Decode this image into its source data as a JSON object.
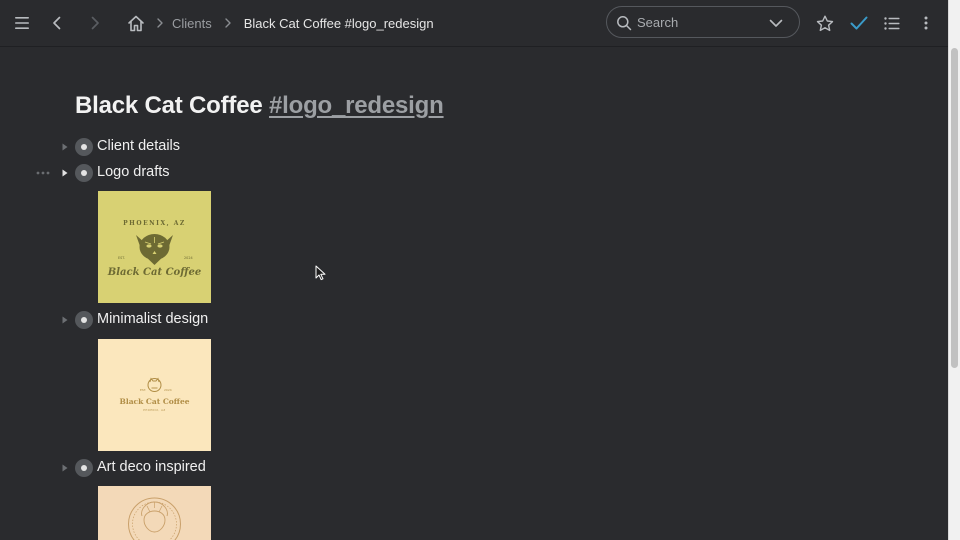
{
  "header": {
    "breadcrumbs": [
      {
        "label": "Clients"
      },
      {
        "label": "Black Cat Coffee #logo_redesign"
      }
    ],
    "search": {
      "placeholder": "Search"
    }
  },
  "page": {
    "title": "Black Cat Coffee ",
    "tag": "#logo_redesign"
  },
  "items": [
    {
      "label": "Client details",
      "expanded": false
    },
    {
      "label": "Logo drafts",
      "expanded": true
    },
    {
      "label": "Minimalist design",
      "expanded": false
    },
    {
      "label": "Art deco inspired",
      "expanded": false
    }
  ],
  "images": [
    {
      "kind": "logo-draft",
      "background": "#d8d173",
      "ink": "#6d6a33",
      "arc_text": "PHOENIX, AZ",
      "left_small": "EST.",
      "right_small": "2024",
      "wordmark": "Black Cat Coffee"
    },
    {
      "kind": "minimalist",
      "background": "#fbe7bd",
      "ink": "#b08d45",
      "left_small": "EST.",
      "right_small": "2024",
      "wordmark": "Black Cat Coffee",
      "subline": "PHOENIX, AZ"
    },
    {
      "kind": "art-deco",
      "background": "#f3d9b8",
      "ink": "#c9a06a"
    }
  ],
  "colors": {
    "background": "#2a2b2e",
    "accent_check": "#3a9bc9",
    "bullet": "#55585c",
    "tag": "#9c9fa3"
  },
  "icons": {
    "menu": "hamburger-menu-icon",
    "back": "chevron-left-icon",
    "forward": "chevron-right-icon",
    "home": "home-icon",
    "search": "search-icon",
    "dropdown": "chevron-down-icon",
    "star": "star-icon",
    "check": "checkmark-icon",
    "list": "list-icon",
    "more": "more-vertical-icon"
  }
}
